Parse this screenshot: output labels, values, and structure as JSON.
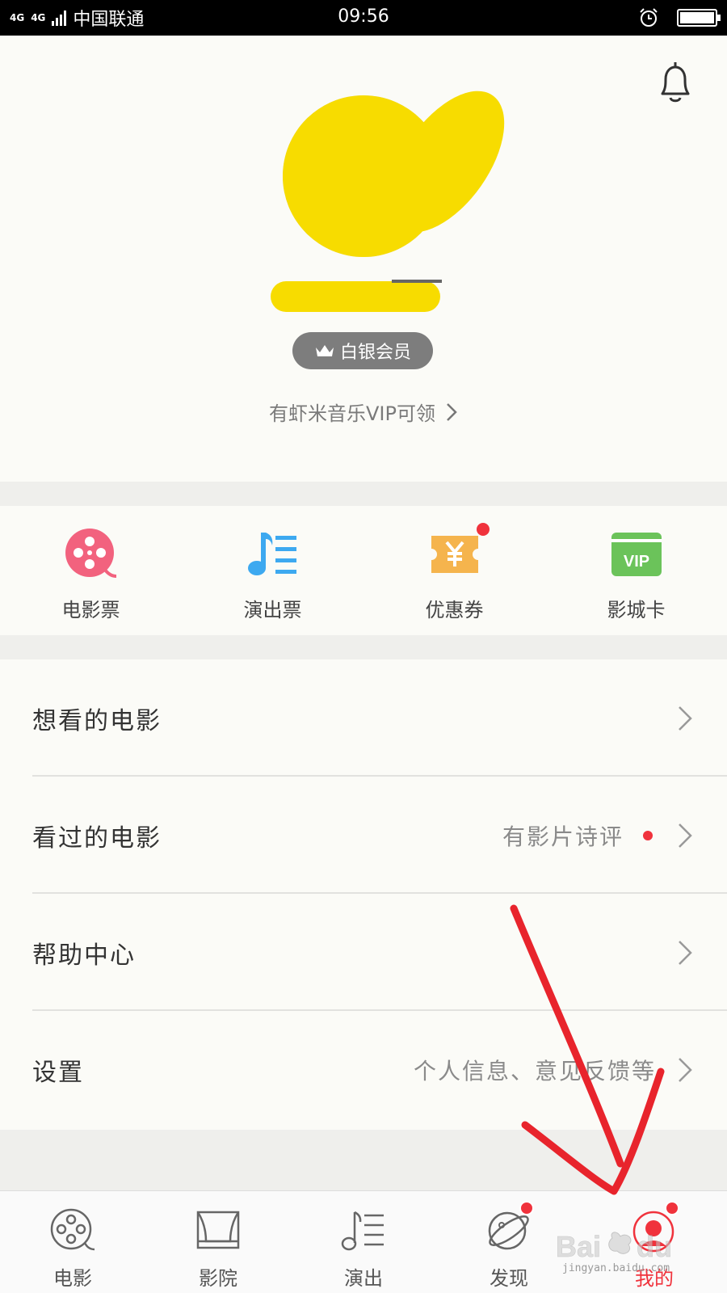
{
  "status_bar": {
    "network": "4G",
    "network2": "4G",
    "carrier": "中国联通",
    "time": "09:56"
  },
  "profile": {
    "member_badge": "白银会员",
    "vip_link": "有虾米音乐VIP可领"
  },
  "quick_actions": [
    {
      "label": "电影票",
      "icon": "film-reel-icon",
      "color": "#f2627e",
      "badge": false
    },
    {
      "label": "演出票",
      "icon": "music-list-icon",
      "color": "#3da9f0",
      "badge": false
    },
    {
      "label": "优惠券",
      "icon": "coupon-icon",
      "color": "#f5b44d",
      "badge": true
    },
    {
      "label": "影城卡",
      "icon": "vip-card-icon",
      "color": "#6bc35a",
      "badge": false,
      "card_text": "VIP"
    }
  ],
  "menu": [
    {
      "title": "想看的电影",
      "hint": ""
    },
    {
      "title": "看过的电影",
      "hint": "有影片诗评"
    },
    {
      "title": "帮助中心",
      "hint": ""
    },
    {
      "title": "设置",
      "hint": "个人信息、意见反馈等"
    }
  ],
  "tab_bar": [
    {
      "label": "电影",
      "icon": "film-reel-icon",
      "badge": false,
      "active": false
    },
    {
      "label": "影院",
      "icon": "cinema-screen-icon",
      "badge": false,
      "active": false
    },
    {
      "label": "演出",
      "icon": "music-list-icon",
      "badge": false,
      "active": false
    },
    {
      "label": "发现",
      "icon": "planet-icon",
      "badge": true,
      "active": false
    },
    {
      "label": "我的",
      "icon": "user-icon",
      "badge": true,
      "active": true
    }
  ],
  "watermark": {
    "brand": "Bai du 经验",
    "url": "jingyan.baidu.com"
  },
  "colors": {
    "accent_red": "#f0323c",
    "badge_gray": "#7d7d7d",
    "annotation_red": "#e8242c"
  }
}
